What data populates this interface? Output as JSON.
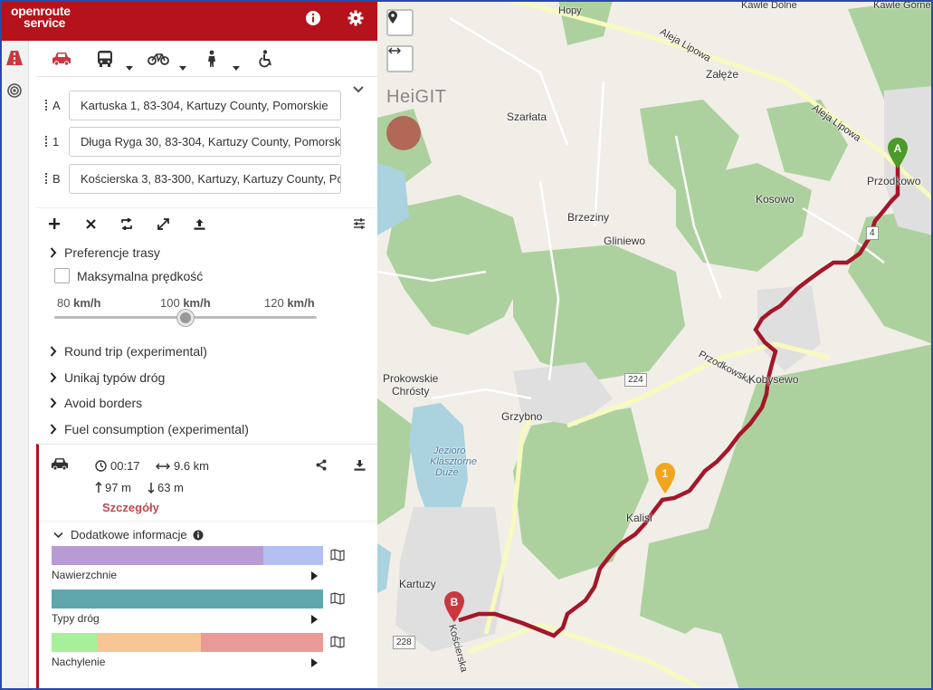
{
  "app": {
    "logo_line1": "openroute",
    "logo_line2": "service"
  },
  "waypoints": [
    {
      "label": "A",
      "value": "Kartuska 1, 83-304, Kartuzy County, Pomorskie"
    },
    {
      "label": "1",
      "value": "Długa Ryga 30, 83-304, Kartuzy County, Pomorskie"
    },
    {
      "label": "B",
      "value": "Kościerska 3, 83-300, Kartuzy, Kartuzy County, Pomorskie"
    }
  ],
  "options": {
    "route_prefs": "Preferencje trasy",
    "max_speed": "Maksymalna prędkość",
    "speed_ticks": [
      {
        "value": "80",
        "unit": "km/h"
      },
      {
        "value": "100",
        "unit": "km/h"
      },
      {
        "value": "120",
        "unit": "km/h"
      }
    ],
    "round_trip": "Round trip (experimental)",
    "avoid_types": "Unikaj typów dróg",
    "avoid_borders": "Avoid borders",
    "fuel": "Fuel consumption (experimental)"
  },
  "summary": {
    "duration": "00:17",
    "distance": "9.6 km",
    "ascent": "97 m",
    "descent": "63 m",
    "details": "Szczegóły",
    "extra_info": "Dodatkowe informacje"
  },
  "extras": [
    {
      "label": "Nawierzchnie",
      "segments": [
        {
          "share": 0.78,
          "color": "#b99bd4"
        },
        {
          "share": 0.22,
          "color": "#b3c0f1"
        }
      ]
    },
    {
      "label": "Typy dróg",
      "segments": [
        {
          "share": 1.0,
          "color": "#5fa6ad"
        }
      ]
    },
    {
      "label": "Nachylenie",
      "segments": [
        {
          "share": 0.17,
          "color": "#a8ef9c"
        },
        {
          "share": 0.38,
          "color": "#f8c594"
        },
        {
          "share": 0.45,
          "color": "#ea9a96"
        }
      ]
    }
  ],
  "map": {
    "watermark": "HeiGIT",
    "places": {
      "hopy": "Hopy",
      "kawle": "Kawle Dolne",
      "kawle_gorne": "Kawle Górne",
      "aleja1": "Aleja Lipowa",
      "aleja2": "Aleja Lipowa",
      "zaleze": "Załęże",
      "szarlata": "Szarłata",
      "przodkowo": "Przodkowo",
      "kosowo": "Kosowo",
      "brzeziny": "Brzeziny",
      "gliniewo": "Gliniewo",
      "przodkowska": "Przodkowska",
      "kobysewo": "Kobysewo",
      "prokowskie": "Prokowskie",
      "chrosty": "Chrósty",
      "grzybno": "Grzybno",
      "jezioro1": "Jezioro",
      "jezioro2": "Klasztorne",
      "jezioro3": "Duże",
      "kalisl": "Kalisl",
      "kartuzy": "Kartuzy",
      "koscierska": "Kościerska"
    },
    "roads": {
      "r224": "224",
      "r228": "228",
      "r4": "4"
    },
    "markers": {
      "start": "A",
      "via": "1",
      "end": "B"
    },
    "route_color": "#a3172a"
  }
}
